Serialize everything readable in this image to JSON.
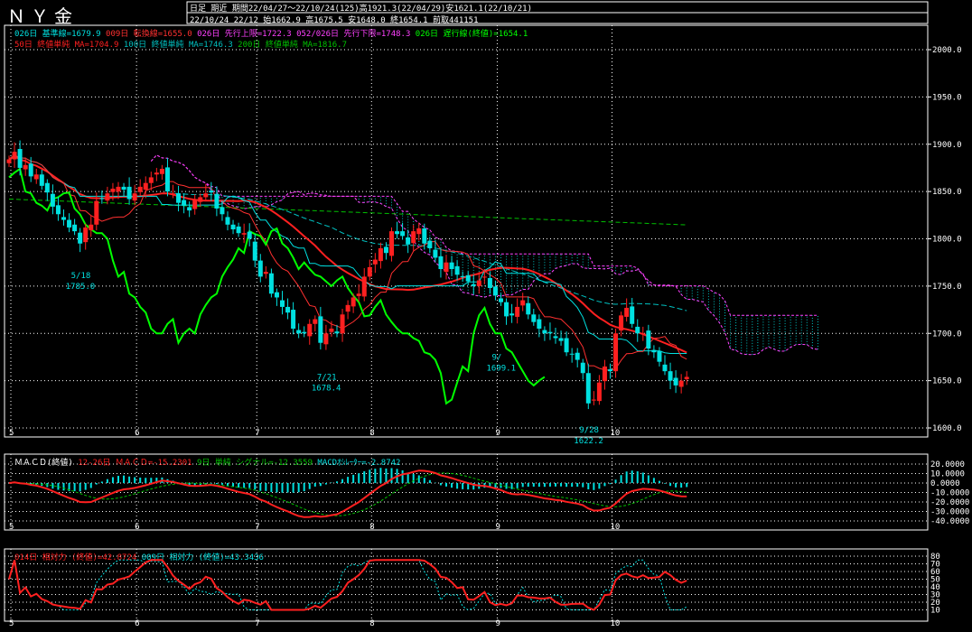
{
  "header": {
    "title": "ＮＹ金",
    "period_kind": "日足 期近",
    "period_info": "期間22/04/27〜22/10/24(125)高1921.3(22/04/29)安1621.1(22/10/21)",
    "latest_info": "22/10/24 22/12 始1662.9 高1675.5 安1648.0 終1654.1 前取441151"
  },
  "colors": {
    "background": "#000000",
    "grid": "#ffffff",
    "up": "#ff2020",
    "down": "#00e0e0",
    "kijun": "#00e0e0",
    "tenkan": "#ff3030",
    "spanA": "#ff40ff",
    "spanB": "#ff40ff",
    "chikou": "#00ff00",
    "ma50": "#ff2020",
    "ma100": "#00c0c0",
    "ma200": "#00c000",
    "macd": "#ff2020",
    "signal": "#00c000",
    "osc": "#00e0e0",
    "rsi14": "#ff2020",
    "rsi9": "#00e0e0"
  },
  "legends": {
    "main1": [
      {
        "text": "026日 基準線=1679.9",
        "color": "#00e0e0"
      },
      {
        "text": "009日 転換線=1655.0",
        "color": "#ff3030"
      },
      {
        "text": "026日 先行上限=1722.3",
        "color": "#ff40ff"
      },
      {
        "text": "052/026日 先行下限=1748.3",
        "color": "#ff40ff"
      },
      {
        "text": "026日 遅行線(終値)=1654.1",
        "color": "#00ff00"
      }
    ],
    "main2": [
      {
        "text": "50日 終値単純 MA=1704.9",
        "color": "#ff2020"
      },
      {
        "text": "100日 終値単純 MA=1746.3",
        "color": "#00c0c0"
      },
      {
        "text": "200日 終値単純 MA=1816.7",
        "color": "#00c000"
      }
    ],
    "macd": [
      {
        "text": "ＭＡＣＤ(終値)",
        "color": "#ffffff"
      },
      {
        "text": "12-26日 ＭＡＣＤ=-15.2301",
        "color": "#ff2020"
      },
      {
        "text": "9日 単純 シグナル=-12.3559",
        "color": "#00c000"
      },
      {
        "text": "MACDｵｼﾚｰﾀｰ=-2.8742",
        "color": "#00e0e0"
      }
    ],
    "rsi": [
      {
        "text": "014日 相対力 (終値)=42.8724",
        "color": "#ff2020"
      },
      {
        "text": "009日 相対力 (終値)=43.3436",
        "color": "#00e0e0"
      }
    ]
  },
  "chart_data": {
    "type": "candlestick",
    "month_labels": [
      "5",
      "6",
      "7",
      "8",
      "9",
      "10"
    ],
    "month_start_index": [
      0,
      23,
      45,
      66,
      89,
      110
    ],
    "price_axis": {
      "min": 1600,
      "max": 2000,
      "ticks": [
        "1600.0",
        "1650.0",
        "1700.0",
        "1750.0",
        "1800.0",
        "1850.0",
        "1900.0",
        "1950.0",
        "2000.0"
      ]
    },
    "macd_axis": {
      "min": -40,
      "max": 20,
      "ticks": [
        "20.0000",
        "10.0000",
        "0.0000",
        "-10.0000",
        "-20.0000",
        "-30.0000",
        "-40.0000"
      ]
    },
    "rsi_axis": {
      "min": 0,
      "max": 80,
      "ticks": [
        "80",
        "70",
        "60",
        "50",
        "40",
        "30",
        "20",
        "10"
      ]
    },
    "annotations": [
      {
        "date": "5/18",
        "value": "1785.0",
        "i": 13,
        "p": 1785
      },
      {
        "date": "7/21",
        "value": "1678.4",
        "i": 58,
        "p": 1678
      },
      {
        "date": "9/",
        "value": "1699.1",
        "i": 90,
        "p": 1699
      },
      {
        "date": "9/28",
        "value": "1622.2",
        "i": 106,
        "p": 1622
      }
    ],
    "close": [
      1884,
      1892,
      1875,
      1878,
      1866,
      1868,
      1856,
      1849,
      1834,
      1826,
      1820,
      1812,
      1808,
      1795,
      1812,
      1815,
      1840,
      1842,
      1848,
      1853,
      1855,
      1852,
      1842,
      1848,
      1855,
      1859,
      1865,
      1870,
      1874,
      1850,
      1848,
      1838,
      1835,
      1830,
      1842,
      1844,
      1848,
      1849,
      1832,
      1826,
      1815,
      1810,
      1806,
      1806,
      1800,
      1777,
      1760,
      1765,
      1742,
      1738,
      1728,
      1722,
      1705,
      1700,
      1700,
      1710,
      1715,
      1690,
      1700,
      1705,
      1700,
      1720,
      1730,
      1738,
      1742,
      1760,
      1770,
      1778,
      1790,
      1785,
      1808,
      1805,
      1803,
      1794,
      1808,
      1811,
      1795,
      1790,
      1780,
      1768,
      1775,
      1768,
      1762,
      1760,
      1755,
      1750,
      1756,
      1760,
      1748,
      1740,
      1733,
      1718,
      1719,
      1728,
      1735,
      1720,
      1712,
      1705,
      1700,
      1700,
      1695,
      1692,
      1680,
      1678,
      1672,
      1658,
      1626,
      1630,
      1648,
      1665,
      1660,
      1700,
      1719,
      1727,
      1710,
      1700,
      1700,
      1684,
      1680,
      1670,
      1660,
      1650,
      1645,
      1650,
      1654
    ]
  }
}
